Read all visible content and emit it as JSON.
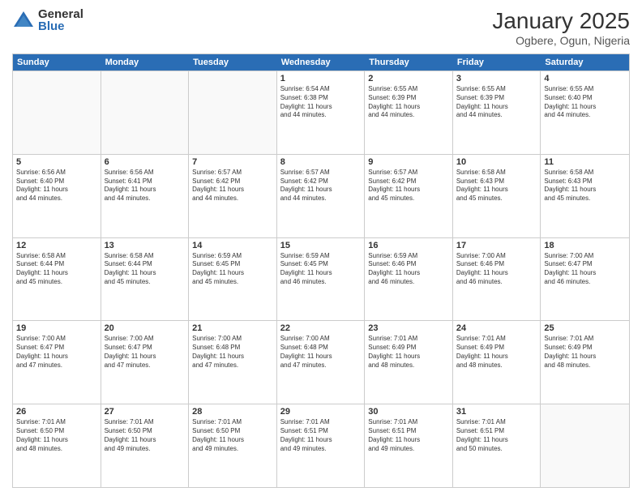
{
  "logo": {
    "general": "General",
    "blue": "Blue"
  },
  "title": {
    "month": "January 2025",
    "location": "Ogbere, Ogun, Nigeria"
  },
  "header": {
    "days": [
      "Sunday",
      "Monday",
      "Tuesday",
      "Wednesday",
      "Thursday",
      "Friday",
      "Saturday"
    ]
  },
  "rows": [
    {
      "cells": [
        {
          "day": "",
          "info": "",
          "empty": true
        },
        {
          "day": "",
          "info": "",
          "empty": true
        },
        {
          "day": "",
          "info": "",
          "empty": true
        },
        {
          "day": "1",
          "info": "Sunrise: 6:54 AM\nSunset: 6:38 PM\nDaylight: 11 hours\nand 44 minutes."
        },
        {
          "day": "2",
          "info": "Sunrise: 6:55 AM\nSunset: 6:39 PM\nDaylight: 11 hours\nand 44 minutes."
        },
        {
          "day": "3",
          "info": "Sunrise: 6:55 AM\nSunset: 6:39 PM\nDaylight: 11 hours\nand 44 minutes."
        },
        {
          "day": "4",
          "info": "Sunrise: 6:55 AM\nSunset: 6:40 PM\nDaylight: 11 hours\nand 44 minutes."
        }
      ]
    },
    {
      "cells": [
        {
          "day": "5",
          "info": "Sunrise: 6:56 AM\nSunset: 6:40 PM\nDaylight: 11 hours\nand 44 minutes."
        },
        {
          "day": "6",
          "info": "Sunrise: 6:56 AM\nSunset: 6:41 PM\nDaylight: 11 hours\nand 44 minutes."
        },
        {
          "day": "7",
          "info": "Sunrise: 6:57 AM\nSunset: 6:42 PM\nDaylight: 11 hours\nand 44 minutes."
        },
        {
          "day": "8",
          "info": "Sunrise: 6:57 AM\nSunset: 6:42 PM\nDaylight: 11 hours\nand 44 minutes."
        },
        {
          "day": "9",
          "info": "Sunrise: 6:57 AM\nSunset: 6:42 PM\nDaylight: 11 hours\nand 45 minutes."
        },
        {
          "day": "10",
          "info": "Sunrise: 6:58 AM\nSunset: 6:43 PM\nDaylight: 11 hours\nand 45 minutes."
        },
        {
          "day": "11",
          "info": "Sunrise: 6:58 AM\nSunset: 6:43 PM\nDaylight: 11 hours\nand 45 minutes."
        }
      ]
    },
    {
      "cells": [
        {
          "day": "12",
          "info": "Sunrise: 6:58 AM\nSunset: 6:44 PM\nDaylight: 11 hours\nand 45 minutes."
        },
        {
          "day": "13",
          "info": "Sunrise: 6:58 AM\nSunset: 6:44 PM\nDaylight: 11 hours\nand 45 minutes."
        },
        {
          "day": "14",
          "info": "Sunrise: 6:59 AM\nSunset: 6:45 PM\nDaylight: 11 hours\nand 45 minutes."
        },
        {
          "day": "15",
          "info": "Sunrise: 6:59 AM\nSunset: 6:45 PM\nDaylight: 11 hours\nand 46 minutes."
        },
        {
          "day": "16",
          "info": "Sunrise: 6:59 AM\nSunset: 6:46 PM\nDaylight: 11 hours\nand 46 minutes."
        },
        {
          "day": "17",
          "info": "Sunrise: 7:00 AM\nSunset: 6:46 PM\nDaylight: 11 hours\nand 46 minutes."
        },
        {
          "day": "18",
          "info": "Sunrise: 7:00 AM\nSunset: 6:47 PM\nDaylight: 11 hours\nand 46 minutes."
        }
      ]
    },
    {
      "cells": [
        {
          "day": "19",
          "info": "Sunrise: 7:00 AM\nSunset: 6:47 PM\nDaylight: 11 hours\nand 47 minutes."
        },
        {
          "day": "20",
          "info": "Sunrise: 7:00 AM\nSunset: 6:47 PM\nDaylight: 11 hours\nand 47 minutes."
        },
        {
          "day": "21",
          "info": "Sunrise: 7:00 AM\nSunset: 6:48 PM\nDaylight: 11 hours\nand 47 minutes."
        },
        {
          "day": "22",
          "info": "Sunrise: 7:00 AM\nSunset: 6:48 PM\nDaylight: 11 hours\nand 47 minutes."
        },
        {
          "day": "23",
          "info": "Sunrise: 7:01 AM\nSunset: 6:49 PM\nDaylight: 11 hours\nand 48 minutes."
        },
        {
          "day": "24",
          "info": "Sunrise: 7:01 AM\nSunset: 6:49 PM\nDaylight: 11 hours\nand 48 minutes."
        },
        {
          "day": "25",
          "info": "Sunrise: 7:01 AM\nSunset: 6:49 PM\nDaylight: 11 hours\nand 48 minutes."
        }
      ]
    },
    {
      "cells": [
        {
          "day": "26",
          "info": "Sunrise: 7:01 AM\nSunset: 6:50 PM\nDaylight: 11 hours\nand 48 minutes."
        },
        {
          "day": "27",
          "info": "Sunrise: 7:01 AM\nSunset: 6:50 PM\nDaylight: 11 hours\nand 49 minutes."
        },
        {
          "day": "28",
          "info": "Sunrise: 7:01 AM\nSunset: 6:50 PM\nDaylight: 11 hours\nand 49 minutes."
        },
        {
          "day": "29",
          "info": "Sunrise: 7:01 AM\nSunset: 6:51 PM\nDaylight: 11 hours\nand 49 minutes."
        },
        {
          "day": "30",
          "info": "Sunrise: 7:01 AM\nSunset: 6:51 PM\nDaylight: 11 hours\nand 49 minutes."
        },
        {
          "day": "31",
          "info": "Sunrise: 7:01 AM\nSunset: 6:51 PM\nDaylight: 11 hours\nand 50 minutes."
        },
        {
          "day": "",
          "info": "",
          "empty": true
        }
      ]
    }
  ]
}
